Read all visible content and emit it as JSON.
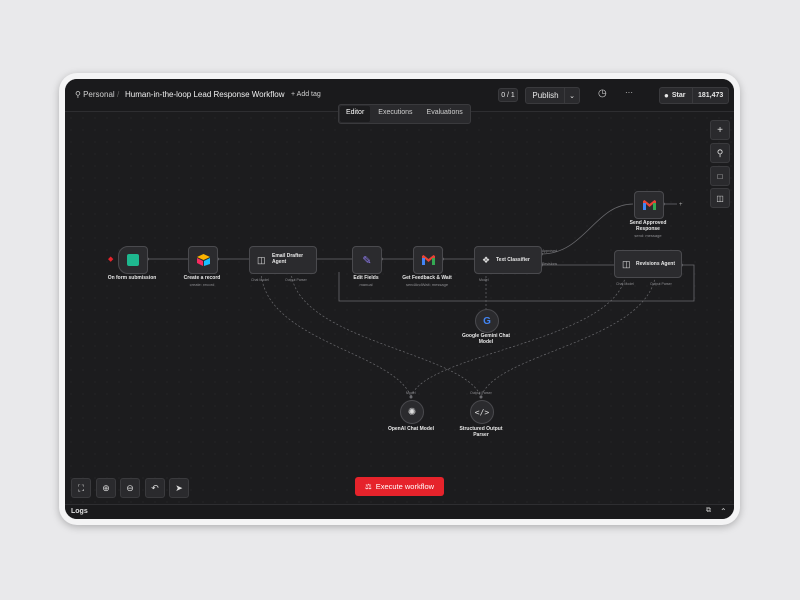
{
  "header": {
    "workspace": "Personal",
    "separator": "/",
    "workflow_name": "Human-in-the-loop Lead Response Workflow",
    "add_tag": "+ Add tag",
    "counter": "0 / 1",
    "publish": "Publish",
    "more": "···",
    "star_label": "Star",
    "star_count": "181,473"
  },
  "tabs": [
    "Editor",
    "Executions",
    "Evaluations"
  ],
  "nodes": {
    "form": {
      "title": "On form submission"
    },
    "airtable": {
      "title": "Create a record",
      "sub": "create: record"
    },
    "drafter": {
      "title1": "Email Drafter",
      "title2": "Agent",
      "port1": "Chat Model",
      "port2": "Output Parser"
    },
    "edit": {
      "title": "Edit Fields",
      "sub": "manual"
    },
    "feedback": {
      "title": "Get Feedback & Wait",
      "sub": "sendAndWait: message"
    },
    "classifier": {
      "title": "Text Classifier",
      "out1": "Approved",
      "out2": "Revisions",
      "port": "Model"
    },
    "send": {
      "title1": "Send Approved",
      "title2": "Response",
      "sub": "send: message"
    },
    "revisions": {
      "title": "Revisions Agent",
      "port1": "Chat Model",
      "port2": "Output Parser"
    },
    "gemini": {
      "title1": "Google Gemini Chat",
      "title2": "Model"
    },
    "openai": {
      "title": "OpenAI Chat Model",
      "port": "Model"
    },
    "parser": {
      "title1": "Structured Output",
      "title2": "Parser",
      "port": "Output Parser"
    }
  },
  "execute_label": "Execute workflow",
  "logs_label": "Logs",
  "icons": {
    "accent": "#e6232b"
  }
}
